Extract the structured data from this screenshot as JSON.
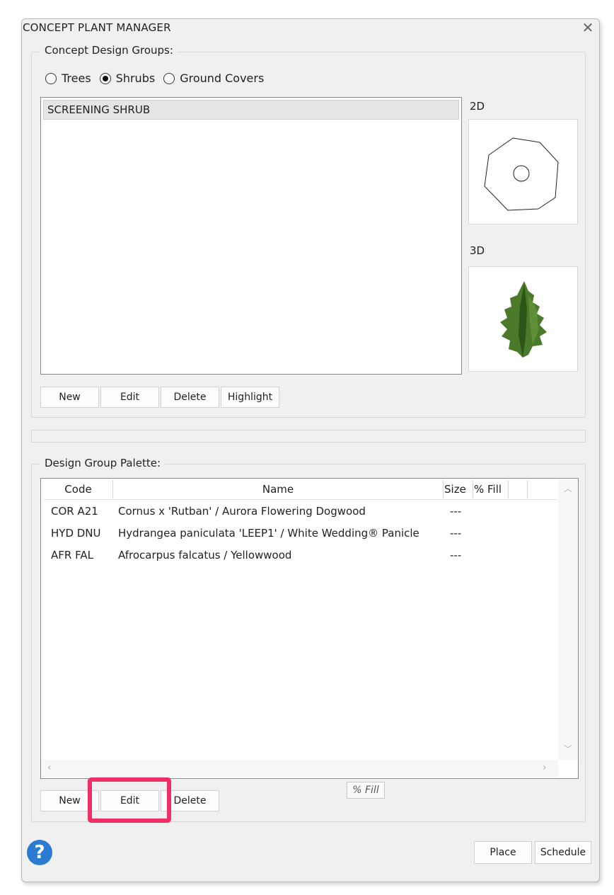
{
  "window": {
    "title": "CONCEPT PLANT MANAGER",
    "close_icon": "close-icon"
  },
  "groups_section": {
    "legend": "Concept Design Groups:",
    "radios": [
      {
        "label": "Trees",
        "checked": false
      },
      {
        "label": "Shrubs",
        "checked": true
      },
      {
        "label": "Ground Covers",
        "checked": false
      }
    ],
    "list_items": [
      "SCREENING SHRUB"
    ],
    "preview_2d_label": "2D",
    "preview_3d_label": "3D",
    "buttons": {
      "new": "New",
      "edit": "Edit",
      "delete": "Delete",
      "highlight": "Highlight"
    }
  },
  "palette_section": {
    "legend": "Design Group Palette:",
    "columns": [
      "Code",
      "Name",
      "Size",
      "% Fill"
    ],
    "rows": [
      {
        "code": "COR A21",
        "name": "Cornus x 'Rutban' / Aurora Flowering Dogwood",
        "size": "---",
        "fill": ""
      },
      {
        "code": "HYD DNU",
        "name": "Hydrangea paniculata 'LEEP1' / White Wedding® Panicle",
        "size": "---",
        "fill": ""
      },
      {
        "code": "AFR FAL",
        "name": "Afrocarpus falcatus / Yellowwood",
        "size": "---",
        "fill": ""
      }
    ],
    "fill_button": "% Fill",
    "buttons": {
      "new": "New",
      "edit": "Edit",
      "delete": "Delete"
    }
  },
  "footer": {
    "help_icon": "help-icon",
    "help_glyph": "?",
    "place": "Place",
    "schedule": "Schedule"
  },
  "colors": {
    "highlight": "#ef2f66",
    "help": "#2b7bd3",
    "leaf": "#4a7a2a"
  }
}
